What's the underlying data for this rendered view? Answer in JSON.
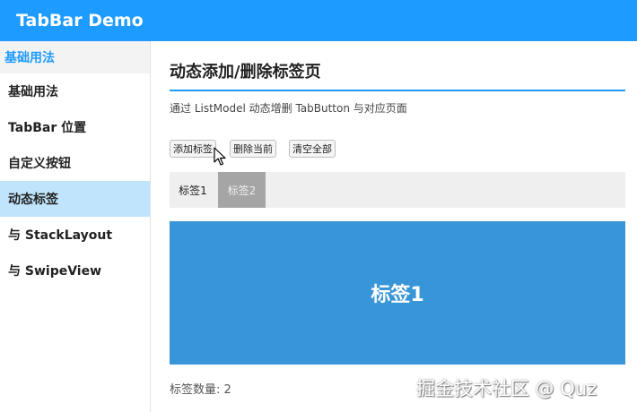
{
  "app": {
    "title": "TabBar Demo"
  },
  "sidebar": {
    "header": "基础用法",
    "items": [
      {
        "label": "基础用法"
      },
      {
        "label": "TabBar 位置"
      },
      {
        "label": "自定义按钮"
      },
      {
        "label": "动态标签",
        "active": true
      },
      {
        "label": "与 StackLayout"
      },
      {
        "label": "与 SwipeView"
      }
    ]
  },
  "main": {
    "title": "动态添加/删除标签页",
    "description": "通过 ListModel 动态增删 TabButton 与对应页面",
    "buttons": {
      "add": "添加标签",
      "remove": "删除当前",
      "clear": "清空全部"
    },
    "tabs": [
      {
        "label": "标签1"
      },
      {
        "label": "标签2",
        "selected": true
      }
    ],
    "content_text": "标签1",
    "count_text": "标签数量: 2"
  },
  "watermark": "掘金技术社区 @ Quz",
  "colors": {
    "accent": "#1e9bff",
    "active_sidebar": "#bfe4fb",
    "content_bg": "#3795d8",
    "selected_tab": "#a5a5a5"
  }
}
